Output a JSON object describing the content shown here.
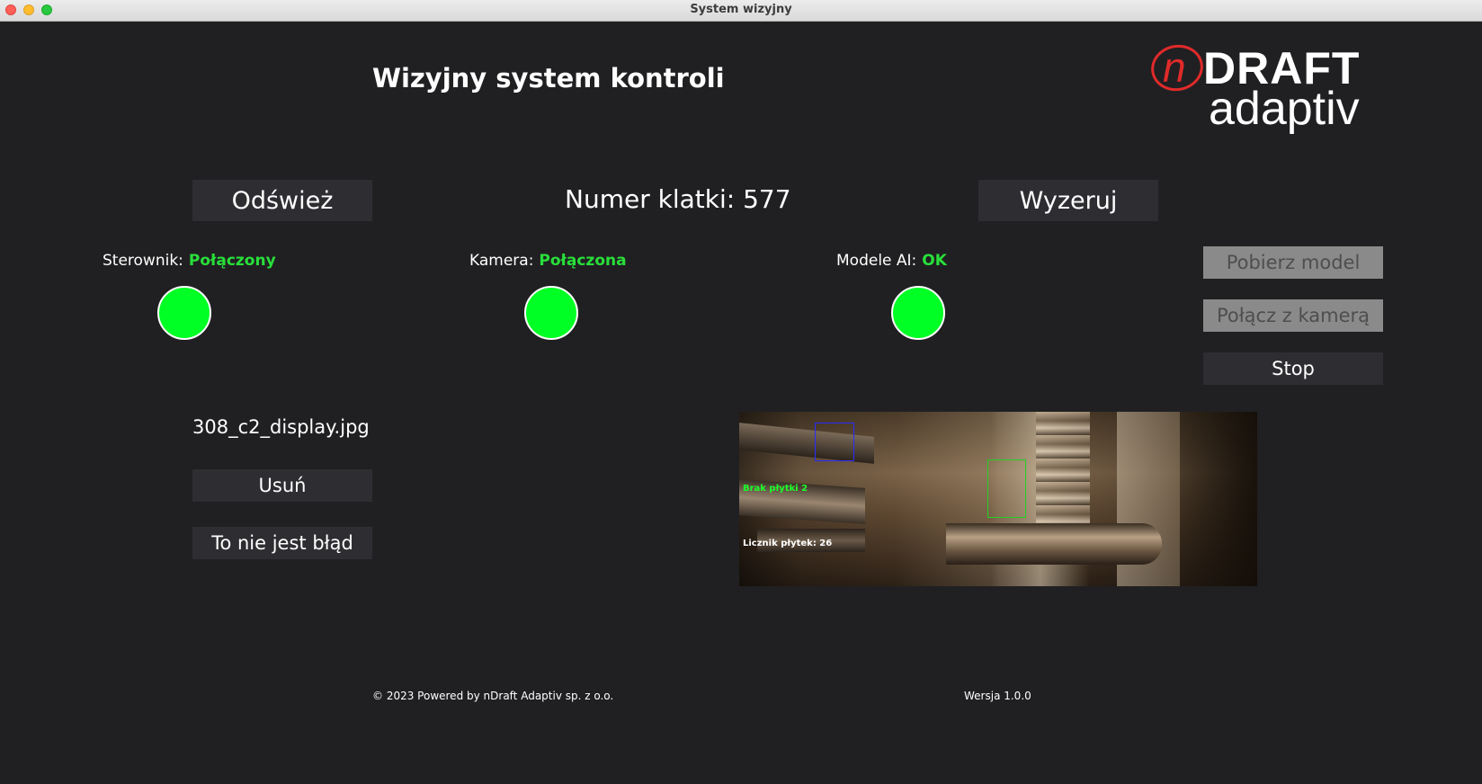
{
  "window": {
    "title": "System wizyjny"
  },
  "header": {
    "title": "Wizyjny system kontroli",
    "logo_primary": "nDRAFT",
    "logo_secondary": "adaptiv"
  },
  "toolbar": {
    "refresh_label": "Odśwież",
    "frame_counter": "Numer klatki: 577",
    "reset_label": "Wyzeruj"
  },
  "status": {
    "controller": {
      "label": "Sterownik:",
      "value": "Połączony",
      "indicator_color": "#00ff24"
    },
    "camera": {
      "label": "Kamera:",
      "value": "Połączona",
      "indicator_color": "#00ff24"
    },
    "models": {
      "label": "Modele AI:",
      "value": "OK",
      "indicator_color": "#00ff24"
    }
  },
  "side_actions": {
    "download_model": {
      "label": "Pobierz model",
      "enabled": false
    },
    "connect_camera": {
      "label": "Połącz z kamerą",
      "enabled": false
    },
    "stop": {
      "label": "Stop",
      "enabled": true
    }
  },
  "detection": {
    "filename": "308_c2_display.jpg",
    "delete_label": "Usuń",
    "not_error_label": "To nie jest błąd"
  },
  "camera_view": {
    "detection_label": "Brak płytki 2",
    "counter_label": "Licznik płytek: 26"
  },
  "footer": {
    "copyright": "© 2023 Powered by nDraft Adaptiv sp. z o.o.",
    "version": "Wersja 1.0.0"
  },
  "colors": {
    "background": "#202022",
    "button": "#2e2e32",
    "button_disabled": "#8a8a8a",
    "status_ok": "#28e03a",
    "logo_red": "#e02a2a"
  }
}
